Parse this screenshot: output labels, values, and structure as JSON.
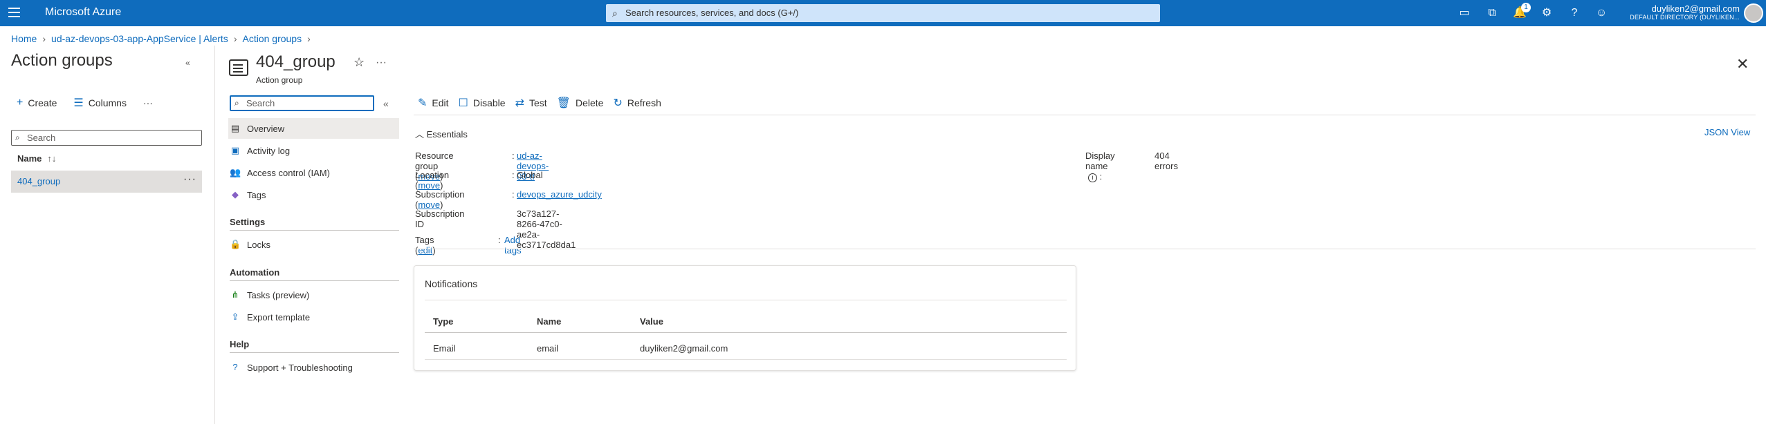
{
  "topbar": {
    "brand": "Microsoft Azure",
    "search_placeholder": "Search resources, services, and docs (G+/)",
    "notification_count": "1",
    "user_email": "duyliken2@gmail.com",
    "user_directory": "DEFAULT DIRECTORY (DUYLIKEN...",
    "icons": [
      "cloud-shell-icon",
      "portal-filter-icon",
      "bell-icon",
      "gear-icon",
      "help-icon",
      "feedback-icon"
    ]
  },
  "breadcrumb": [
    {
      "label": "Home"
    },
    {
      "label": "ud-az-devops-03-app-AppService | Alerts"
    },
    {
      "label": "Action groups"
    }
  ],
  "left_panel": {
    "title": "Action groups",
    "create_label": "Create",
    "columns_label": "Columns",
    "more_label": "···",
    "search_placeholder": "Search",
    "column_header": "Name",
    "sort_glyph": "↑↓",
    "rows": [
      {
        "name": "404_group"
      }
    ]
  },
  "resource": {
    "title": "404_group",
    "subtitle": "Action group",
    "more_label": "···"
  },
  "menu": {
    "search_placeholder": "Search",
    "items_top": [
      {
        "label": "Overview",
        "icon": "overview-icon"
      },
      {
        "label": "Activity log",
        "icon": "activity-log-icon"
      },
      {
        "label": "Access control (IAM)",
        "icon": "people-icon"
      },
      {
        "label": "Tags",
        "icon": "tag-icon"
      }
    ],
    "sections": [
      {
        "title": "Settings",
        "items": [
          {
            "label": "Locks",
            "icon": "lock-icon"
          }
        ]
      },
      {
        "title": "Automation",
        "items": [
          {
            "label": "Tasks (preview)",
            "icon": "tasks-icon"
          },
          {
            "label": "Export template",
            "icon": "export-template-icon"
          }
        ]
      },
      {
        "title": "Help",
        "items": [
          {
            "label": "Support + Troubleshooting",
            "icon": "help-circle-icon"
          }
        ]
      }
    ]
  },
  "commands": {
    "edit": "Edit",
    "disable": "Disable",
    "test": "Test",
    "delete": "Delete",
    "refresh": "Refresh"
  },
  "essentials": {
    "header": "Essentials",
    "json_view": "JSON View",
    "resource_group_label": "Resource group",
    "resource_group_value": "ud-az-devops-03-tf",
    "location_label": "Location",
    "location_value": "Global",
    "subscription_label": "Subscription",
    "subscription_value": "devops_azure_udcity",
    "subscription_id_label": "Subscription ID",
    "subscription_id_value": "3c73a127-8266-47c0-ae2a-ec3717cd8da1",
    "move_label": "move",
    "display_name_label": "Display name",
    "display_name_value": "404 errors",
    "tags_label": "Tags",
    "tags_edit": "edit",
    "add_tags": "Add tags"
  },
  "notifications": {
    "title": "Notifications",
    "columns": [
      "Type",
      "Name",
      "Value"
    ],
    "rows": [
      {
        "type": "Email",
        "name": "email",
        "value": "duyliken2@gmail.com"
      }
    ]
  }
}
